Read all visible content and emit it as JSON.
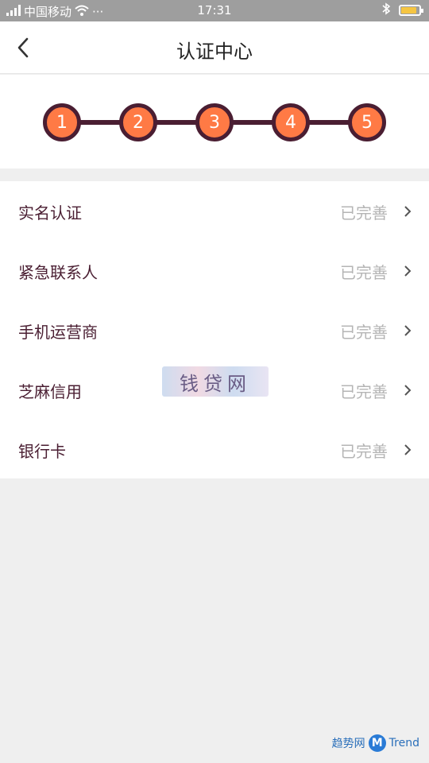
{
  "status_bar": {
    "signal_icon": "signal-icon",
    "carrier": "中国移动",
    "wifi_icon": "wifi-icon",
    "more": "···",
    "time": "17:31",
    "bluetooth_icon": "bluetooth-icon",
    "battery_icon": "battery-icon"
  },
  "nav": {
    "back_icon": "chevron-left-icon",
    "title": "认证中心"
  },
  "steps": [
    "1",
    "2",
    "3",
    "4",
    "5"
  ],
  "list": {
    "items": [
      {
        "label": "实名认证",
        "status": "已完善"
      },
      {
        "label": "紧急联系人",
        "status": "已完善"
      },
      {
        "label": "手机运营商",
        "status": "已完善"
      },
      {
        "label": "芝麻信用",
        "status": "已完善"
      },
      {
        "label": "银行卡",
        "status": "已完善"
      }
    ]
  },
  "watermarks": {
    "center": "钱贷网",
    "corner_cn": "趋势网",
    "corner_badge": "M",
    "corner_en": "Trend"
  },
  "colors": {
    "accent": "#ff7a45",
    "dark": "#4a1e32",
    "muted": "#b5b5b5"
  }
}
